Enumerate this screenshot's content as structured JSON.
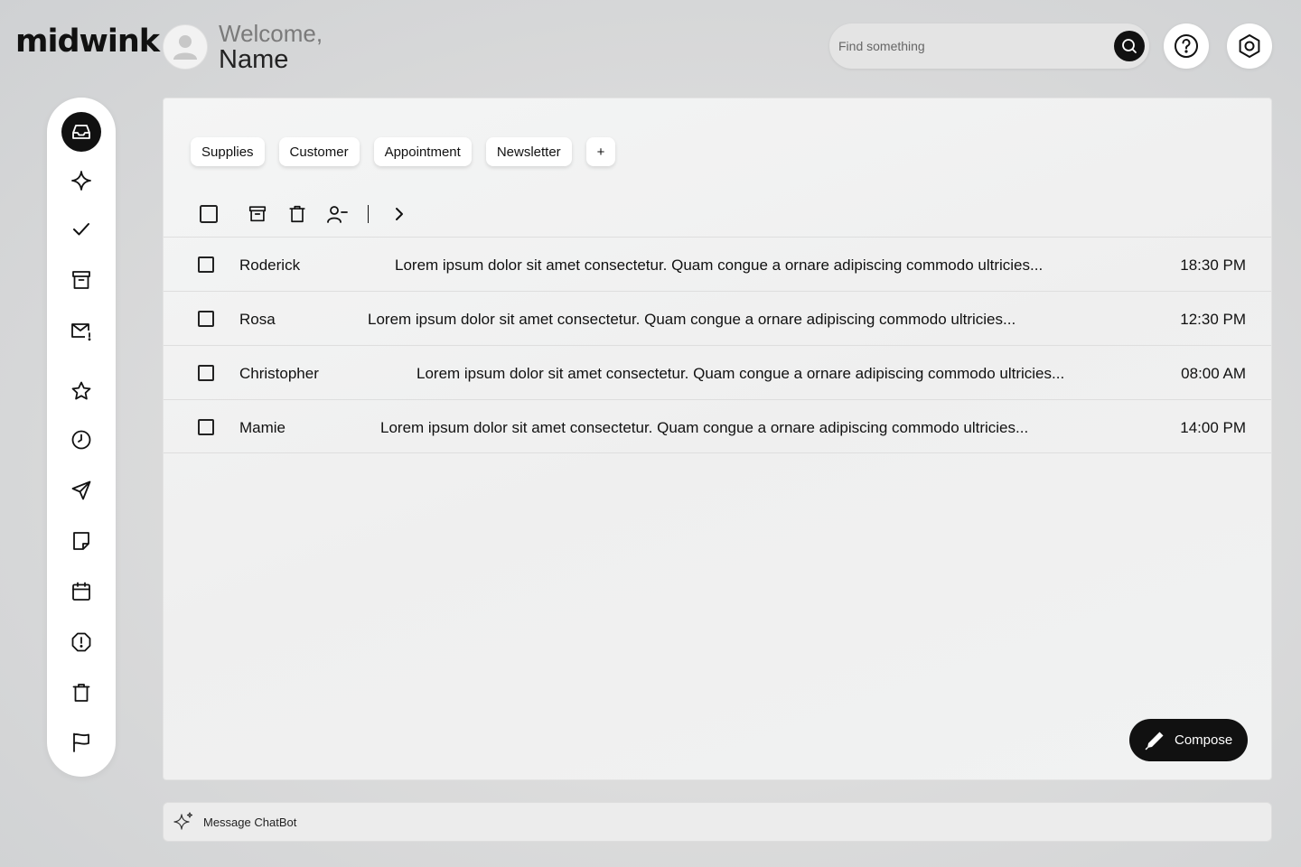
{
  "header": {
    "logo": "midwink",
    "welcome_line": "Welcome,",
    "user_name": "Name",
    "search_placeholder": "Find something"
  },
  "sidebar": {
    "items": [
      {
        "name": "inbox",
        "icon": "inbox-icon",
        "active": true
      },
      {
        "name": "sparkle",
        "icon": "sparkle-icon"
      },
      {
        "name": "done",
        "icon": "check-icon"
      },
      {
        "name": "archive",
        "icon": "archive-icon"
      },
      {
        "name": "important-mail",
        "icon": "mail-alert-icon"
      },
      {
        "name": "starred",
        "icon": "star-icon"
      },
      {
        "name": "snoozed",
        "icon": "clock-icon"
      },
      {
        "name": "sent",
        "icon": "send-icon"
      },
      {
        "name": "drafts",
        "icon": "document-icon"
      },
      {
        "name": "scheduled",
        "icon": "calendar-icon"
      },
      {
        "name": "spam",
        "icon": "alert-octagon-icon"
      },
      {
        "name": "trash",
        "icon": "trash-icon"
      },
      {
        "name": "flagged",
        "icon": "flag-icon"
      }
    ]
  },
  "tags": [
    "Supplies",
    "Customer",
    "Appointment",
    "Newsletter",
    "+"
  ],
  "messages": [
    {
      "sender": "Roderick",
      "preview": "Lorem ipsum dolor sit amet consectetur. Quam congue a ornare adipiscing commodo ultricies...",
      "time": "18:30 PM"
    },
    {
      "sender": "Rosa",
      "preview": "Lorem ipsum dolor sit amet consectetur. Quam congue a ornare adipiscing commodo ultricies...",
      "time": "12:30 PM"
    },
    {
      "sender": "Christopher",
      "preview": "Lorem ipsum dolor sit amet consectetur. Quam congue a ornare adipiscing commodo ultricies...",
      "time": "08:00 AM"
    },
    {
      "sender": "Mamie",
      "preview": "Lorem ipsum dolor sit amet consectetur. Quam congue a ornare adipiscing commodo ultricies...",
      "time": "14:00 PM"
    }
  ],
  "compose_label": "Compose",
  "chatbot_placeholder": "Message ChatBot",
  "colors": {
    "accent": "#111111",
    "panel": "#f1f2f2",
    "background": "#d8d9da"
  }
}
